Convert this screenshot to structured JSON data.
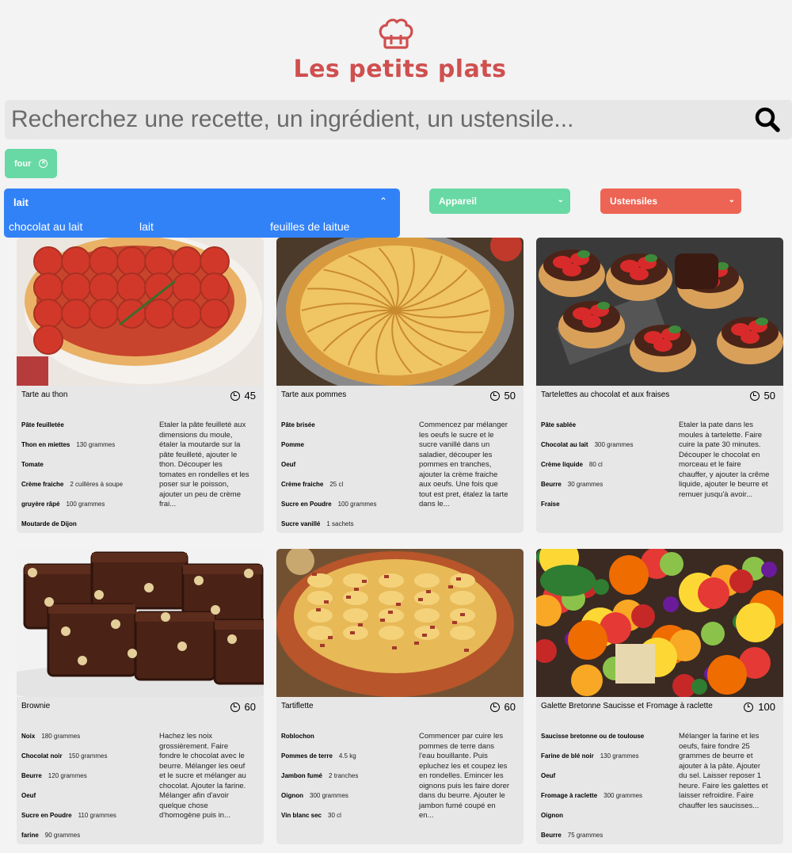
{
  "brand": {
    "title": "Les petits plats"
  },
  "search": {
    "placeholder": "Recherchez une recette, un ingrédient, un ustensile..."
  },
  "tags": [
    {
      "label": "four",
      "color": "#68D9A4"
    }
  ],
  "filters": {
    "ingredients": {
      "value": "lait",
      "options": [
        "chocolat au lait",
        "lait",
        "feuilles de laitue"
      ],
      "color": "#3282F7"
    },
    "appareil": {
      "label": "Appareil",
      "color": "#68D9A4"
    },
    "ustensiles": {
      "label": "Ustensiles",
      "color": "#ED6454"
    }
  },
  "recipes": [
    {
      "title": "Tarte au thon",
      "time": "45",
      "image": "tomato-tart-photo",
      "ingredients": [
        {
          "name": "Pâte feuilletée",
          "qty": ""
        },
        {
          "name": "Thon en miettes",
          "qty": "130 grammes"
        },
        {
          "name": "Tomate",
          "qty": ""
        },
        {
          "name": "Crème fraiche",
          "qty": "2 cuillères à soupe"
        },
        {
          "name": "gruyère râpé",
          "qty": "100 grammes"
        },
        {
          "name": "Moutarde de Dijon",
          "qty": ""
        }
      ],
      "description": "Etaler la pâte feuilleté aux dimensions du moule, étaler la moutarde sur la pâte feuilleté, ajouter le thon. Découper les tomates en rondelles et les poser sur le poisson, ajouter un peu de crème frai..."
    },
    {
      "title": "Tarte aux pommes",
      "time": "50",
      "image": "apple-tart-photo",
      "ingredients": [
        {
          "name": "Pâte brisée",
          "qty": ""
        },
        {
          "name": "Pomme",
          "qty": ""
        },
        {
          "name": "Oeuf",
          "qty": ""
        },
        {
          "name": "Crème fraiche",
          "qty": "25 cl"
        },
        {
          "name": "Sucre en Poudre",
          "qty": "100 grammes"
        },
        {
          "name": "Sucre vanillé",
          "qty": "1 sachets"
        }
      ],
      "description": "Commencez par mélanger les oeufs le sucre et le sucre vanillé dans un saladier, découper les pommes en tranches, ajouter la crème fraiche aux oeufs. Une fois que tout est pret, étalez la tarte dans le..."
    },
    {
      "title": "Tartelettes au chocolat et aux fraises",
      "time": "50",
      "image": "strawberry-tartlets-photo",
      "ingredients": [
        {
          "name": "Pâte sablée",
          "qty": ""
        },
        {
          "name": "Chocolat au lait",
          "qty": "300 grammes"
        },
        {
          "name": "Crème liquide",
          "qty": "80 cl"
        },
        {
          "name": "Beurre",
          "qty": "30 grammes"
        },
        {
          "name": "Fraise",
          "qty": ""
        }
      ],
      "description": "Etaler la pate dans les moules à tartelette. Faire cuire la pate 30 minutes. Découper le chocolat en morceau et le faire chauffer, y ajouter la crême liquide, ajouter le beurre et remuer jusqu'à avoir..."
    },
    {
      "title": "Brownie",
      "time": "60",
      "image": "brownie-photo",
      "ingredients": [
        {
          "name": "Noix",
          "qty": "180 grammes"
        },
        {
          "name": "Chocolat noir",
          "qty": "150 grammes"
        },
        {
          "name": "Beurre",
          "qty": "120 grammes"
        },
        {
          "name": "Oeuf",
          "qty": ""
        },
        {
          "name": "Sucre en Poudre",
          "qty": "110 grammes"
        },
        {
          "name": "farine",
          "qty": "90 grammes"
        }
      ],
      "description": "Hachez les noix grossièrement. Faire fondre le chocolat avec le beurre. Mélanger les oeuf et le sucre et mélanger au chocolat. Ajouter la farine. Mélanger afin d'avoir quelque chose d'homogène puis in..."
    },
    {
      "title": "Tartiflette",
      "time": "60",
      "image": "tartiflette-photo",
      "ingredients": [
        {
          "name": "Roblochon",
          "qty": ""
        },
        {
          "name": "Pommes de terre",
          "qty": "4.5 kg"
        },
        {
          "name": "Jambon fumé",
          "qty": "2 tranches"
        },
        {
          "name": "Oignon",
          "qty": "300 grammes"
        },
        {
          "name": "Vin blanc sec",
          "qty": "30 cl"
        }
      ],
      "description": "Commencer par cuire les pommes de terre dans l'eau bouillante. Puis epluchez les et coupez les en rondelles. Emincer les oignons puis les faire dorer dans du beurre. Ajouter le jambon fumé coupé en en..."
    },
    {
      "title": "Galette Bretonne Saucisse et Fromage à raclette",
      "time": "100",
      "image": "vegetables-photo",
      "ingredients": [
        {
          "name": "Saucisse bretonne ou de toulouse",
          "qty": ""
        },
        {
          "name": "Farine de blé noir",
          "qty": "130 grammes"
        },
        {
          "name": "Oeuf",
          "qty": ""
        },
        {
          "name": "Fromage à raclette",
          "qty": "300 grammes"
        },
        {
          "name": "Oignon",
          "qty": ""
        },
        {
          "name": "Beurre",
          "qty": "75 grammes"
        }
      ],
      "description": "Mélanger la farine et les oeufs, faire fondre 25 grammes de beurre et ajouter à la pâte. Ajouter du sel. Laisser reposer 1 heure. Faire les galettes et laisser refroidire. Faire chauffer les saucisses..."
    }
  ]
}
